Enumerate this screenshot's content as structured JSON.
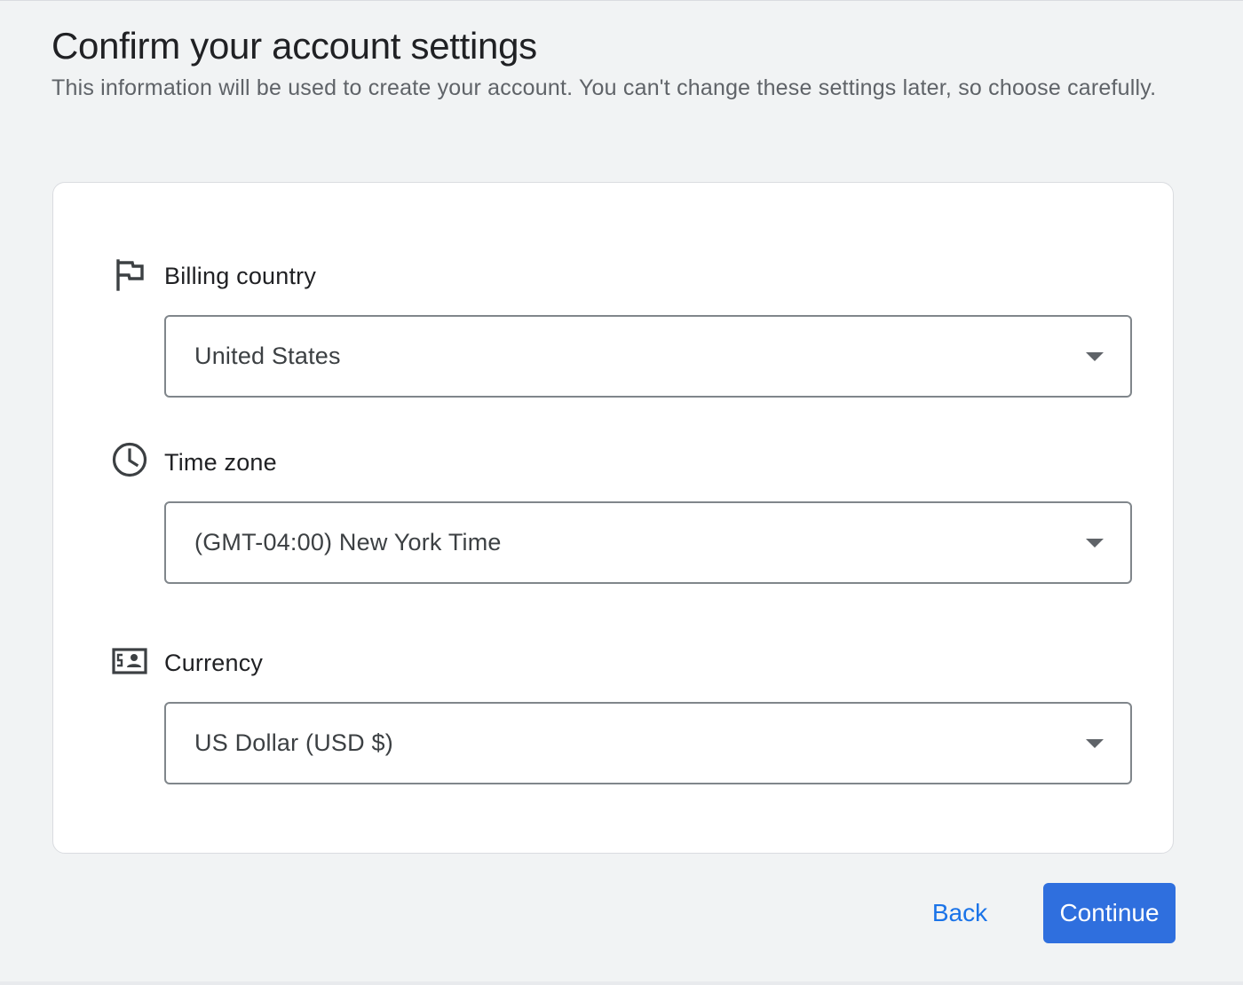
{
  "header": {
    "title": "Confirm your account settings",
    "subtitle": "This information will be used to create your account. You can't change these settings later, so choose carefully."
  },
  "fields": {
    "billing_country": {
      "icon": "flag-icon",
      "label": "Billing country",
      "value": "United States"
    },
    "time_zone": {
      "icon": "clock-icon",
      "label": "Time zone",
      "value": "(GMT-04:00) New York Time"
    },
    "currency": {
      "icon": "currency-icon",
      "label": "Currency",
      "value": "US Dollar (USD $)"
    }
  },
  "actions": {
    "back_label": "Back",
    "continue_label": "Continue"
  },
  "colors": {
    "accent": "#1a73e8",
    "primary_button": "#2f6fde",
    "background": "#f1f3f4",
    "card": "#ffffff"
  }
}
